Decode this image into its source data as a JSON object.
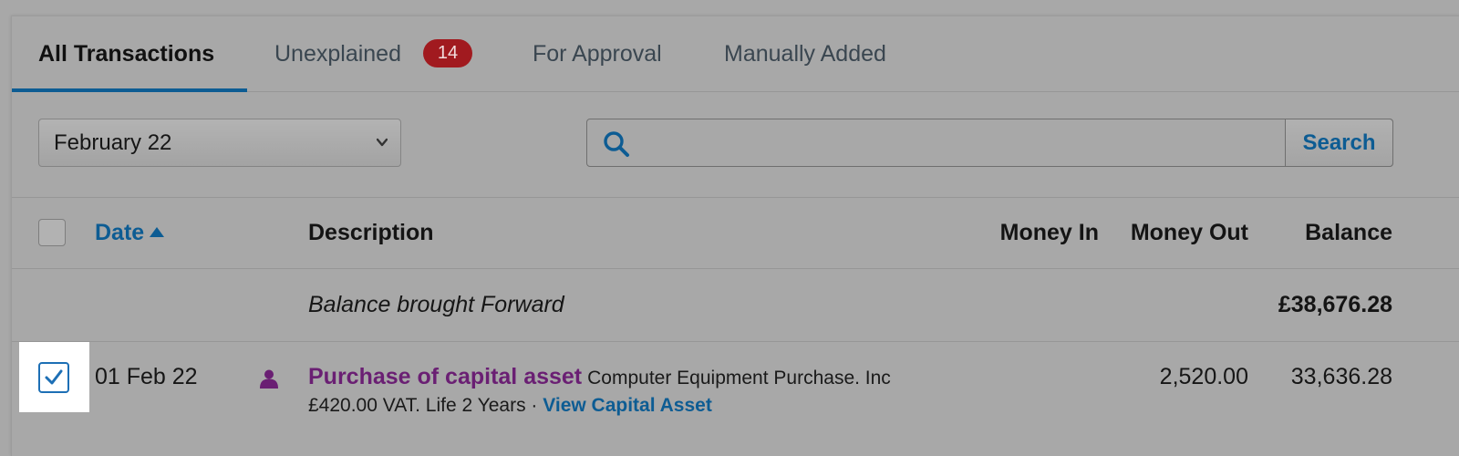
{
  "tabs": [
    {
      "label": "All Transactions"
    },
    {
      "label": "Unexplained",
      "badge": "14"
    },
    {
      "label": "For Approval"
    },
    {
      "label": "Manually Added"
    }
  ],
  "filters": {
    "month_value": "February 22",
    "search_placeholder": "",
    "search_button": "Search"
  },
  "columns": {
    "date": "Date",
    "description": "Description",
    "money_in": "Money In",
    "money_out": "Money Out",
    "balance": "Balance"
  },
  "rows": {
    "brought_forward": {
      "label": "Balance brought Forward",
      "balance": "£38,676.28"
    },
    "transaction": {
      "checked": true,
      "date": "01 Feb 22",
      "title": "Purchase of capital asset",
      "detail": "Computer Equipment Purchase. Inc",
      "line2": "£420.00 VAT. Life 2 Years · ",
      "line2_link": "View Capital Asset",
      "money_out": "2,520.00",
      "balance": "33,636.28"
    }
  },
  "colors": {
    "accent": "#0d5c93",
    "badge": "#a11a1f",
    "link_purple": "#6a1f73"
  }
}
